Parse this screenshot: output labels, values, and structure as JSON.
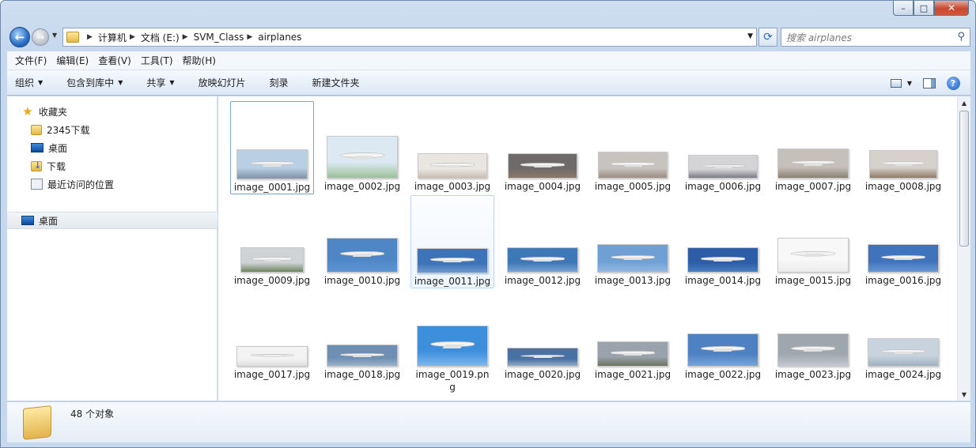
{
  "window": {
    "caption": {
      "minimize": "–",
      "maximize": "□",
      "close": "✕"
    }
  },
  "address": {
    "crumbs": [
      "计算机",
      "文档 (E:)",
      "SVM_Class",
      "airplanes"
    ],
    "search_placeholder": "搜索 airplanes"
  },
  "menu": [
    "文件(F)",
    "编辑(E)",
    "查看(V)",
    "工具(T)",
    "帮助(H)"
  ],
  "toolbar": {
    "organize": "组织",
    "include_library": "包含到库中",
    "share": "共享",
    "slideshow": "放映幻灯片",
    "burn": "刻录",
    "new_folder": "新建文件夹"
  },
  "nav": {
    "favorites": "收藏夹",
    "items": [
      "2345下载",
      "桌面",
      "下载",
      "最近访问的位置"
    ],
    "desktop": "桌面"
  },
  "files": [
    {
      "name": "image_0001.jpg",
      "sky": "#b9cfe3",
      "ground": "#7e93a8",
      "w": 90,
      "h": 38
    },
    {
      "name": "image_0002.jpg",
      "sky": "#dde9f2",
      "ground": "#9cc09a",
      "w": 90,
      "h": 54
    },
    {
      "name": "image_0003.jpg",
      "sky": "#e9e6e2",
      "ground": "#c8bdb2",
      "w": 88,
      "h": 32
    },
    {
      "name": "image_0004.jpg",
      "sky": "#6f6a6a",
      "ground": "#8c7767",
      "w": 88,
      "h": 32
    },
    {
      "name": "image_0005.jpg",
      "sky": "#c7c3bf",
      "ground": "#9c8e83",
      "w": 88,
      "h": 34
    },
    {
      "name": "image_0006.jpg",
      "sky": "#d4d3d6",
      "ground": "#7a7b84",
      "w": 88,
      "h": 30
    },
    {
      "name": "image_0007.jpg",
      "sky": "#c5c0b9",
      "ground": "#8a8272",
      "w": 90,
      "h": 38
    },
    {
      "name": "image_0008.jpg",
      "sky": "#d7d1cb",
      "ground": "#8f7a66",
      "w": 86,
      "h": 36
    },
    {
      "name": "image_0009.jpg",
      "sky": "#cfd3d6",
      "ground": "#6e8560",
      "w": 80,
      "h": 32
    },
    {
      "name": "image_0010.jpg",
      "sky": "#4e86c6",
      "ground": "#5f94d2",
      "w": 90,
      "h": 44
    },
    {
      "name": "image_0011.jpg",
      "sky": "#3d73b8",
      "ground": "#6e9ad0",
      "w": 90,
      "h": 32
    },
    {
      "name": "image_0012.jpg",
      "sky": "#3e78b6",
      "ground": "#7aa4d3",
      "w": 90,
      "h": 32
    },
    {
      "name": "image_0013.jpg",
      "sky": "#6f9fd3",
      "ground": "#93b8e0",
      "w": 90,
      "h": 36
    },
    {
      "name": "image_0014.jpg",
      "sky": "#2c5da6",
      "ground": "#4d7fc2",
      "w": 90,
      "h": 32
    },
    {
      "name": "image_0015.jpg",
      "sky": "#f8f8f8",
      "ground": "#ececec",
      "w": 90,
      "h": 44
    },
    {
      "name": "image_0016.jpg",
      "sky": "#3f74bc",
      "ground": "#6896d1",
      "w": 90,
      "h": 36
    },
    {
      "name": "image_0017.jpg",
      "sky": "#f3f3f3",
      "ground": "#dedede",
      "w": 90,
      "h": 26
    },
    {
      "name": "image_0018.jpg",
      "sky": "#6e8fb3",
      "ground": "#9bb2c9",
      "w": 90,
      "h": 28
    },
    {
      "name": "image_0019.png",
      "sky": "#3d8edb",
      "ground": "#7bb7ee",
      "w": 90,
      "h": 52
    },
    {
      "name": "image_0020.jpg",
      "sky": "#4a71a4",
      "ground": "#95acc7",
      "w": 90,
      "h": 24
    },
    {
      "name": "image_0021.jpg",
      "sky": "#9aa2ab",
      "ground": "#6b7560",
      "w": 90,
      "h": 32
    },
    {
      "name": "image_0022.jpg",
      "sky": "#4d81c2",
      "ground": "#7ba5d6",
      "w": 90,
      "h": 42
    },
    {
      "name": "image_0023.jpg",
      "sky": "#9ea6ae",
      "ground": "#c3c9ce",
      "w": 90,
      "h": 42
    },
    {
      "name": "image_0024.jpg",
      "sky": "#c9d3dd",
      "ground": "#9fb0c0",
      "w": 90,
      "h": 36
    }
  ],
  "status": {
    "count": "48 个对象"
  }
}
